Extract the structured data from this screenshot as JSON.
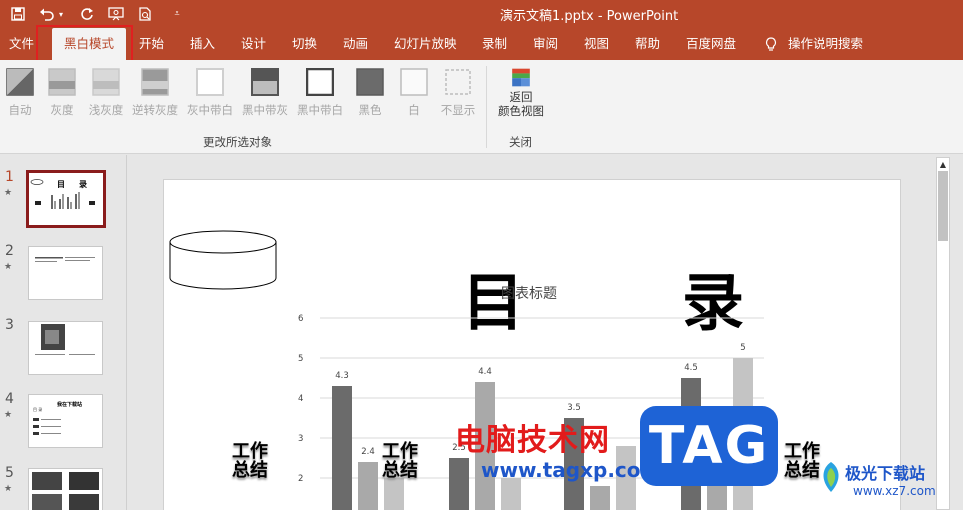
{
  "titlebar": {
    "document_title": "演示文稿1.pptx  -  PowerPoint",
    "quick_access": [
      "save-icon",
      "undo-icon",
      "redo-icon",
      "slideshow-from-start-icon",
      "print-preview-icon",
      "customize-icon"
    ]
  },
  "tabs": [
    {
      "label": "文件"
    },
    {
      "label": "黑白模式",
      "active": true
    },
    {
      "label": "开始"
    },
    {
      "label": "插入"
    },
    {
      "label": "设计"
    },
    {
      "label": "切换"
    },
    {
      "label": "动画"
    },
    {
      "label": "幻灯片放映"
    },
    {
      "label": "录制"
    },
    {
      "label": "审阅"
    },
    {
      "label": "视图"
    },
    {
      "label": "帮助"
    },
    {
      "label": "百度网盘"
    },
    {
      "label": "操作说明搜索"
    }
  ],
  "ribbon": {
    "buttons": [
      {
        "label": "自动"
      },
      {
        "label": "灰度"
      },
      {
        "label": "浅灰度"
      },
      {
        "label": "逆转灰度"
      },
      {
        "label": "灰中带白"
      },
      {
        "label": "黑中带灰"
      },
      {
        "label": "黑中带白"
      },
      {
        "label": "黑色"
      },
      {
        "label": "白"
      },
      {
        "label": "不显示"
      }
    ],
    "group1_label": "更改所选对象",
    "return_button": {
      "line1": "返回",
      "line2": "颜色视图"
    },
    "group2_label": "关闭"
  },
  "slides_panel": {
    "items": [
      {
        "number": "1",
        "star": "★"
      },
      {
        "number": "2",
        "star": "★"
      },
      {
        "number": "3",
        "star": "★"
      },
      {
        "number": "4",
        "star": "★"
      },
      {
        "number": "5",
        "star": "★"
      }
    ],
    "thumb1": {
      "left_char": "目",
      "right_char": "录"
    },
    "thumb4": {
      "title": "我在下载站",
      "sub": "目 录"
    }
  },
  "slide": {
    "char_left": "目",
    "char_right": "录",
    "work_summary": "工作\n总结"
  },
  "chart_data": {
    "type": "bar",
    "title": "图表标题",
    "ylim": [
      0,
      6
    ],
    "yticks": [
      2,
      3,
      4,
      5,
      6
    ],
    "groups": [
      {
        "values": [
          4.3,
          2.4,
          2
        ]
      },
      {
        "values": [
          2.5,
          4.4,
          2
        ]
      },
      {
        "values": [
          3.5,
          1.8,
          2.8
        ]
      },
      {
        "values": [
          4.5,
          2.8,
          5
        ]
      }
    ],
    "value_labels": [
      "4.3",
      "2.4",
      "2.5",
      "4.4",
      "3.5",
      "4.5",
      "5"
    ],
    "series_colors": [
      "#6b6b6b",
      "#a9a9a9",
      "#c4c4c4"
    ]
  },
  "watermark": {
    "site_cn": "电脑技术网",
    "site_url": "www.tagxp.com",
    "tag": "TAG",
    "jg_name": "极光下载站",
    "jg_url": "www.xz7.com"
  }
}
